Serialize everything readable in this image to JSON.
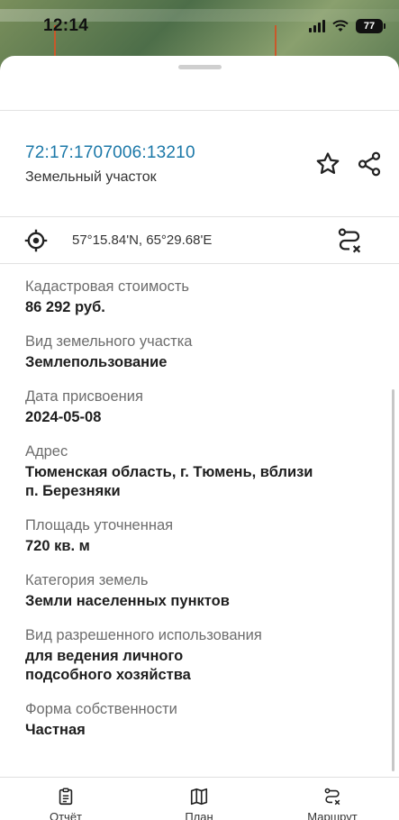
{
  "status_bar": {
    "time": "12:14",
    "battery": "77",
    "icons": [
      "signal-icon",
      "wifi-icon",
      "battery-icon"
    ]
  },
  "object": {
    "cadastral_number": "72:17:1707006:13210",
    "type": "Земельный участок",
    "coordinates": "57°15.84'N, 65°29.68'E"
  },
  "properties": [
    {
      "label": "Кадастровая стоимость",
      "value": "86 292 руб."
    },
    {
      "label": "Вид земельного участка",
      "value": "Землепользование"
    },
    {
      "label": "Дата присвоения",
      "value": "2024-05-08"
    },
    {
      "label": "Адрес",
      "value": [
        "Тюменская область, г. Тюмень, вблизи",
        "п. Березняки"
      ]
    },
    {
      "label": "Площадь уточненная",
      "value": "720 кв. м"
    },
    {
      "label": "Категория земель",
      "value": "Земли населенных пунктов"
    },
    {
      "label": "Вид разрешенного использования",
      "value": [
        "для ведения личного",
        "подсобного хозяйства"
      ]
    },
    {
      "label": "Форма собственности",
      "value": "Частная"
    }
  ],
  "tabs": [
    {
      "label": "Отчёт",
      "icon": "report-icon"
    },
    {
      "label": "План",
      "icon": "map-icon"
    },
    {
      "label": "Маршрут",
      "icon": "route-icon"
    }
  ],
  "colors": {
    "accent": "#1b78a8",
    "label": "#6d6d6d",
    "value": "#1e1e1e"
  }
}
